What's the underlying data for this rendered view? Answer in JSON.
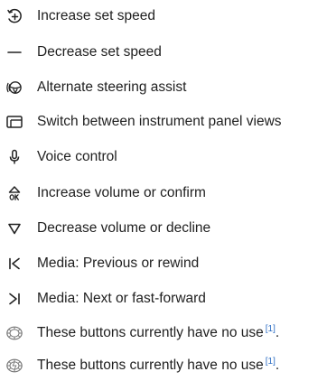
{
  "legend": {
    "items": [
      {
        "icon": "increase-set-speed-icon",
        "label": "Increase set speed"
      },
      {
        "icon": "minus-icon",
        "label": "Decrease set speed"
      },
      {
        "icon": "steering-wheel-assist-icon",
        "label": "Alternate steering assist"
      },
      {
        "icon": "instrument-panel-views-icon",
        "label": "Switch between instrument panel views"
      },
      {
        "icon": "microphone-icon",
        "label": "Voice control"
      },
      {
        "icon": "volume-up-ok-icon",
        "label": "Increase volume or confirm"
      },
      {
        "icon": "triangle-down-icon",
        "label": "Decrease volume or decline"
      },
      {
        "icon": "previous-track-icon",
        "label": "Media: Previous or rewind"
      },
      {
        "icon": "next-track-icon",
        "label": "Media: Next or fast-forward"
      },
      {
        "icon": "left-button-cluster-icon",
        "label": "These buttons currently have no use",
        "ref": "[1]",
        "suffix": "."
      },
      {
        "icon": "right-button-cluster-icon",
        "label": "These buttons currently have no use",
        "ref": "[1]",
        "suffix": "."
      }
    ]
  },
  "colors": {
    "text": "#1f1f1f",
    "reference_link": "#2f6fc4"
  }
}
